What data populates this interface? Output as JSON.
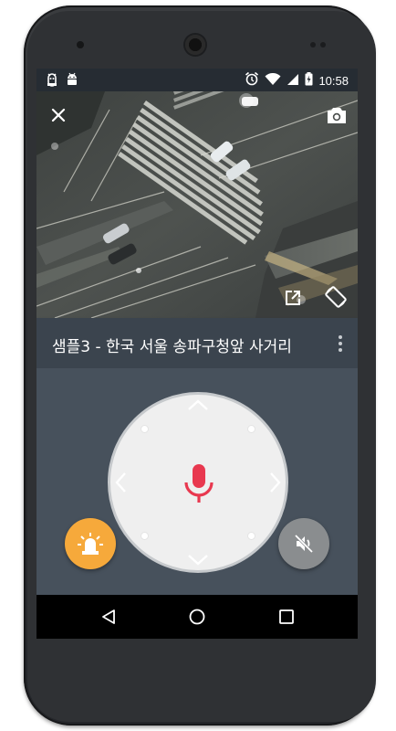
{
  "status_bar": {
    "time": "10:58",
    "left_icons": [
      "android-debug-icon",
      "android-icon"
    ],
    "right_icons": [
      "alarm-icon",
      "wifi-icon",
      "signal-icon",
      "battery-charging-icon"
    ]
  },
  "video": {
    "icons": {
      "close": "close-icon",
      "snapshot": "camera-icon",
      "open_external": "open-external-icon",
      "rotate": "screen-rotation-icon"
    }
  },
  "camera": {
    "title": "샘플3 - 한국 서울 송파구청앞 사거리",
    "menu_icon": "more-vert-icon"
  },
  "controls": {
    "center_icon": "microphone-icon",
    "directions": [
      "up",
      "down",
      "left",
      "right"
    ],
    "siren_icon": "siren-icon",
    "mute_icon": "volume-off-icon",
    "colors": {
      "mic": "#e8384f",
      "siren_button": "#f6a93b",
      "mute_button": "#8a8d8f",
      "panel_bg": "#47515c",
      "title_bg": "#3b444e"
    }
  },
  "nav_bar": {
    "icons": [
      "back-icon",
      "home-icon",
      "recents-icon"
    ]
  }
}
